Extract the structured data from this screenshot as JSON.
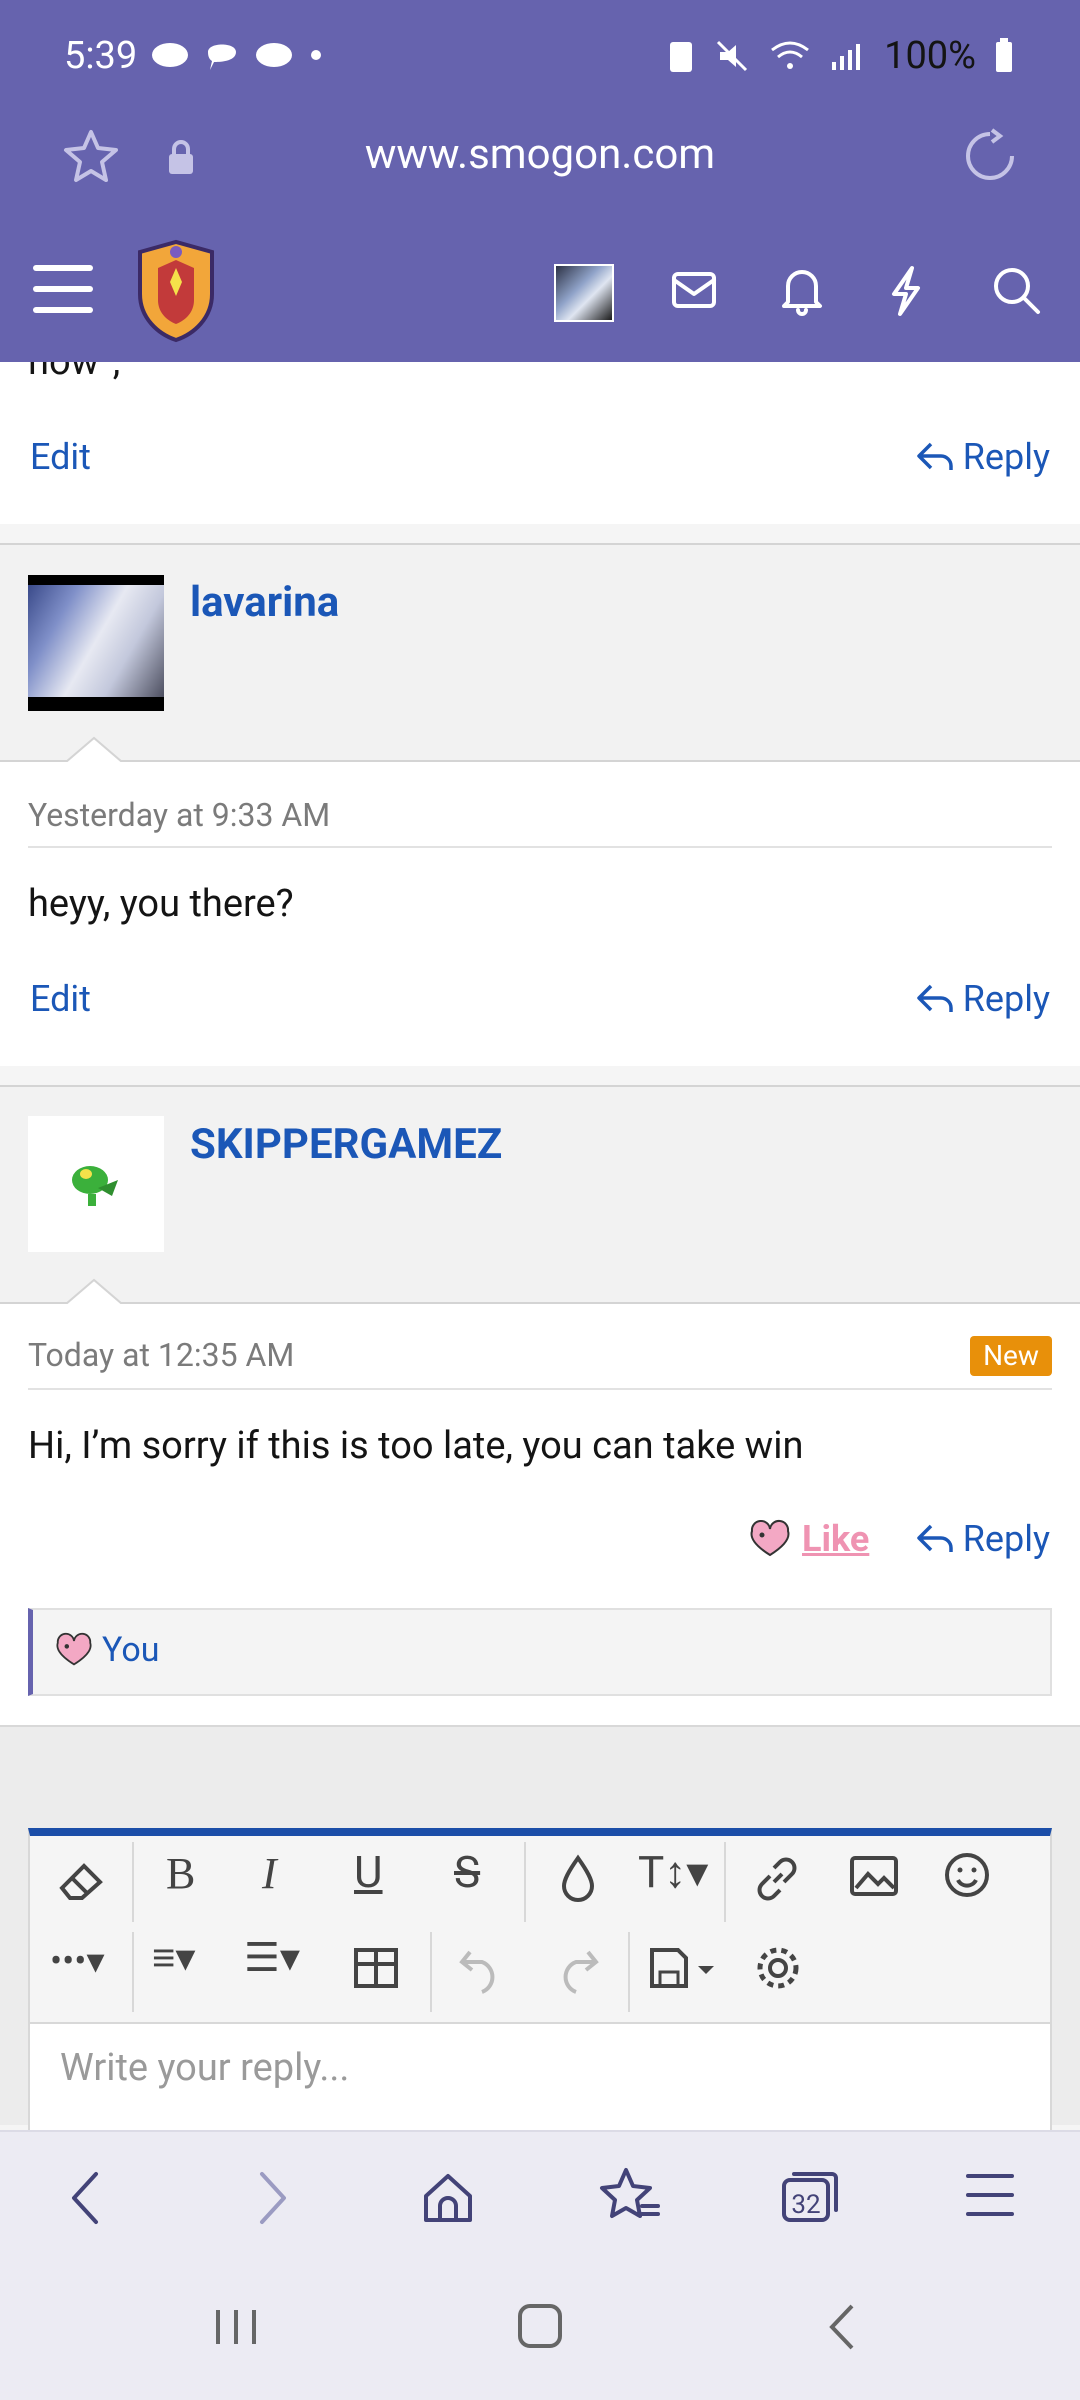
{
  "status": {
    "time": "5:39",
    "battery": "100%"
  },
  "browser": {
    "url": "www.smogon.com",
    "tab_count": "32"
  },
  "posts": [
    {
      "prev_text_fragment": "now”,",
      "edit_label": "Edit",
      "reply_label": "Reply"
    },
    {
      "username": "lavarina",
      "timestamp": "Yesterday at 9:33 AM",
      "message": "heyy, you there?",
      "edit_label": "Edit",
      "reply_label": "Reply"
    },
    {
      "username": "SKIPPERGAMEZ",
      "timestamp": "Today at 12:35 AM",
      "badge": "New",
      "message": "Hi, I’m sorry if this is too late, you can take win",
      "like_label": "Like",
      "reply_label": "Reply",
      "reaction_user": "You"
    }
  ],
  "editor": {
    "placeholder": "Write your reply..."
  },
  "colors": {
    "header": "#6663ae",
    "link": "#1b57b7",
    "badge": "#e8900a",
    "like": "#ef93b2"
  }
}
